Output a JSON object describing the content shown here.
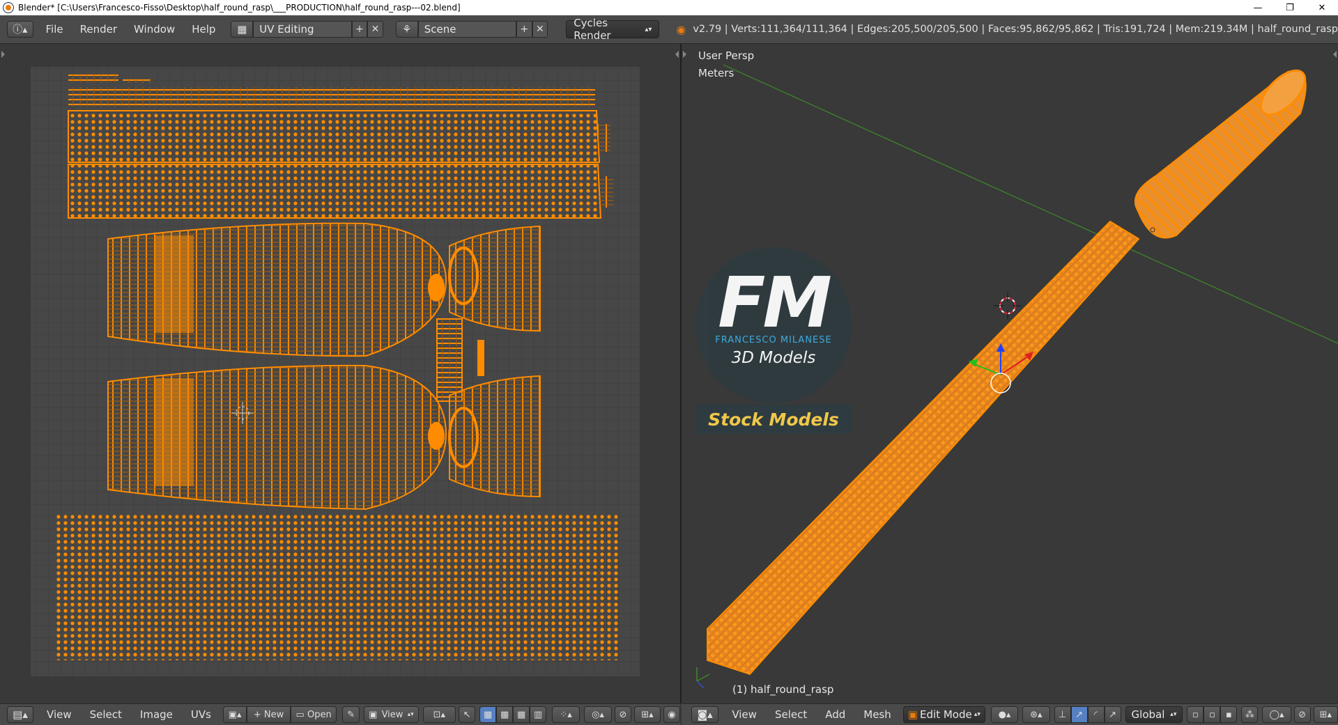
{
  "window": {
    "title": "Blender* [C:\\Users\\Francesco-Fisso\\Desktop\\half_round_rasp\\___PRODUCTION\\half_round_rasp---02.blend]",
    "minimize": "—",
    "restore": "❐",
    "close": "✕"
  },
  "topbar": {
    "menus": [
      "File",
      "Render",
      "Window",
      "Help"
    ],
    "screen_layout": "UV Editing",
    "scene": "Scene",
    "render_engine": "Cycles Render",
    "stats": "v2.79 | Verts:111,364/111,364 | Edges:205,500/205,500 | Faces:95,862/95,862 | Tris:191,724 | Mem:219.34M | half_round_rasp"
  },
  "uv_editor": {
    "menus": [
      "View",
      "Select",
      "Image",
      "UVs"
    ],
    "new_label": "New",
    "open_label": "Open",
    "view_label": "View"
  },
  "viewport": {
    "view_name": "User Persp",
    "units": "Meters",
    "object_label": "(1) half_round_rasp",
    "menus": [
      "View",
      "Select",
      "Add",
      "Mesh"
    ],
    "mode": "Edit Mode",
    "orientation": "Global"
  },
  "watermark": {
    "logo_letters": "FM",
    "brand": "FRANCESCO MILANESE",
    "line2": "3D Models",
    "line3": "Stock Models"
  },
  "colors": {
    "uv_orange": "#ff8c00",
    "accent": "#e87d0d"
  }
}
